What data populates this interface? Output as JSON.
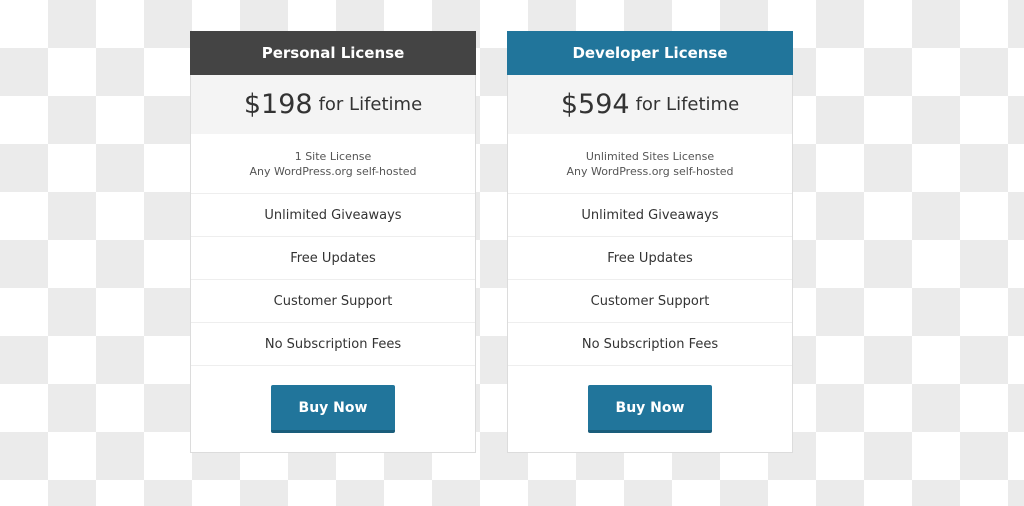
{
  "plans": [
    {
      "name": "Personal License",
      "price": "$198",
      "period": "for Lifetime",
      "license_line1": "1 Site License",
      "license_line2": "Any WordPress.org self-hosted",
      "features": [
        "Unlimited Giveaways",
        "Free Updates",
        "Customer Support",
        "No Subscription Fees"
      ],
      "button_label": "Buy Now",
      "header_color": "#444444"
    },
    {
      "name": "Developer License",
      "price": "$594",
      "period": "for Lifetime",
      "license_line1": "Unlimited Sites License",
      "license_line2": "Any WordPress.org self-hosted",
      "features": [
        "Unlimited Giveaways",
        "Free Updates",
        "Customer Support",
        "No Subscription Fees"
      ],
      "button_label": "Buy Now",
      "header_color": "#21759b"
    }
  ],
  "colors": {
    "accent": "#21759b",
    "dark_header": "#444444"
  }
}
